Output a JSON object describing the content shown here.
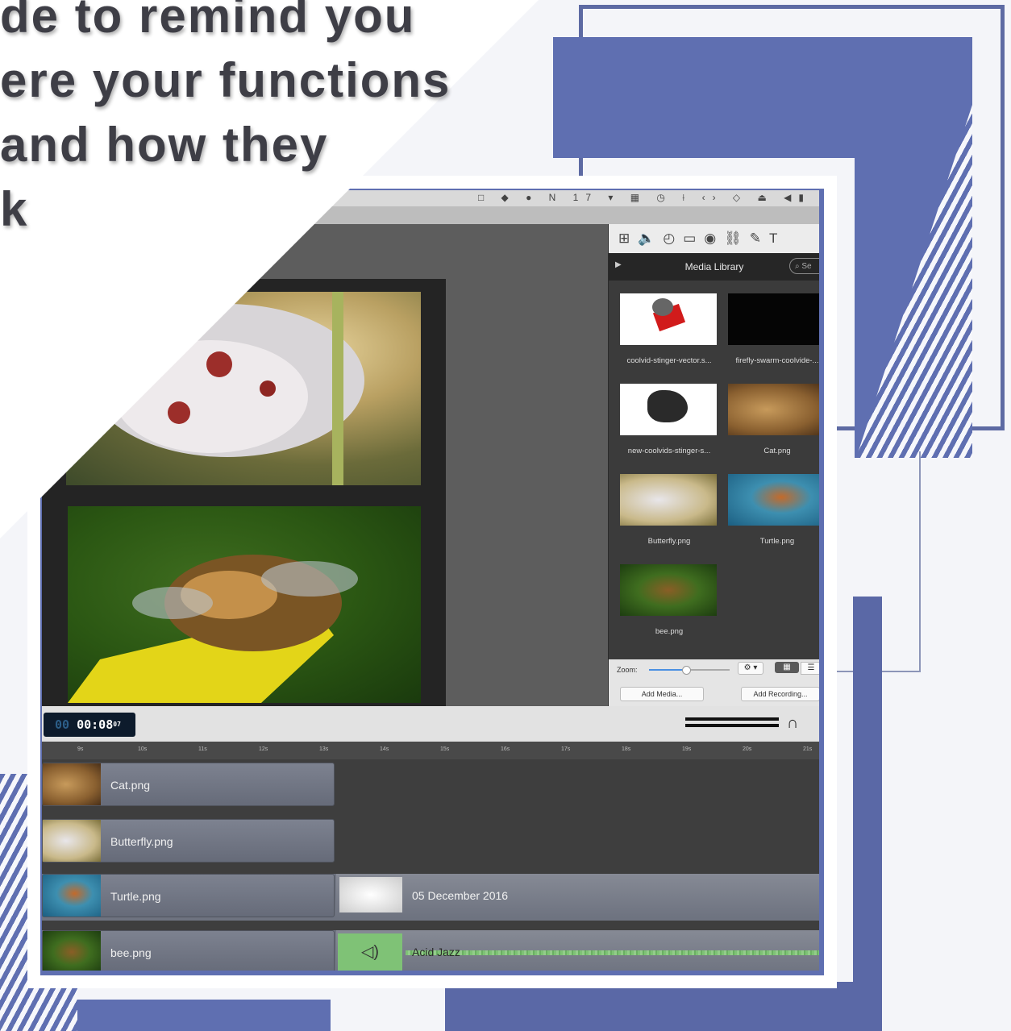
{
  "headline": {
    "lines": [
      "de to remind you",
      "ere your functions",
      "and how they",
      "k"
    ]
  },
  "colors": {
    "accent": "#5f6fb1",
    "timecode_bg": "#0d1b2c",
    "wave": "#7fc276"
  },
  "menubar": {
    "status_text": "N 17"
  },
  "media_library": {
    "tools": [
      "layout-icon",
      "speaker-icon",
      "timer-icon",
      "monitor-icon",
      "target-icon",
      "link-icon",
      "pen-icon",
      "text-icon"
    ],
    "title": "Media Library",
    "search_placeholder": "Se",
    "items": [
      {
        "name": "coolvid-stinger-vector.s...",
        "thumb": "vector"
      },
      {
        "name": "firefly-swarm-coolvide-...",
        "thumb": "black"
      },
      {
        "name": "new-coolvids-stinger-s...",
        "thumb": "ink"
      },
      {
        "name": "Cat.png",
        "thumb": "cat"
      },
      {
        "name": "Butterfly.png",
        "thumb": "butterfly"
      },
      {
        "name": "Turtle.png",
        "thumb": "turtle"
      },
      {
        "name": "bee.png",
        "thumb": "bee"
      }
    ],
    "zoom_label": "Zoom:",
    "zoom_level": 0.45,
    "add_media": "Add Media...",
    "add_recording": "Add Recording..."
  },
  "timecode": {
    "prefix": "00",
    "time": "00:08",
    "frames": "07"
  },
  "ruler": [
    "9s",
    "10s",
    "11s",
    "12s",
    "13s",
    "14s",
    "15s",
    "16s",
    "17s",
    "18s",
    "19s",
    "20s",
    "21s"
  ],
  "tracks": [
    {
      "label": "Cat.png",
      "thumb": "cat"
    },
    {
      "label": "Butterfly.png",
      "thumb": "butterfly"
    },
    {
      "label": "Turtle.png",
      "thumb": "turtle",
      "second_clip": "05 December 2016"
    },
    {
      "label": "bee.png",
      "thumb": "bee",
      "audio_clip": "Acid Jazz"
    }
  ]
}
